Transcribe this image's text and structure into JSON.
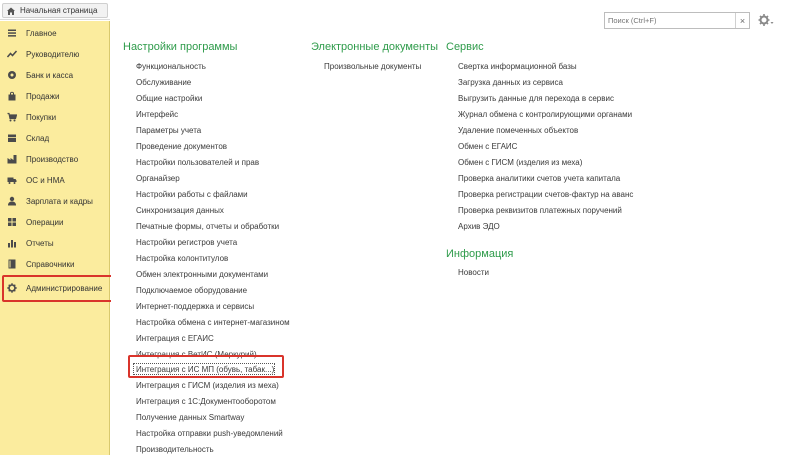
{
  "home_tab": {
    "label": "Начальная страница"
  },
  "sidebar": {
    "items": [
      {
        "label": "Главное",
        "icon": "list-icon"
      },
      {
        "label": "Руководителю",
        "icon": "trend-icon"
      },
      {
        "label": "Банк и касса",
        "icon": "coins-icon"
      },
      {
        "label": "Продажи",
        "icon": "shopping-bag-icon"
      },
      {
        "label": "Покупки",
        "icon": "cart-icon"
      },
      {
        "label": "Склад",
        "icon": "box-icon"
      },
      {
        "label": "Производство",
        "icon": "factory-icon"
      },
      {
        "label": "ОС и НМА",
        "icon": "truck-icon"
      },
      {
        "label": "Зарплата и кадры",
        "icon": "user-icon"
      },
      {
        "label": "Операции",
        "icon": "operations-icon"
      },
      {
        "label": "Отчеты",
        "icon": "bar-chart-icon"
      },
      {
        "label": "Справочники",
        "icon": "book-icon"
      },
      {
        "label": "Администрирование",
        "icon": "gear-icon"
      }
    ]
  },
  "search": {
    "placeholder": "Поиск (Ctrl+F)",
    "clear": "×"
  },
  "sections": {
    "settings": {
      "title": "Настройки программы",
      "links": [
        "Функциональность",
        "Обслуживание",
        "Общие настройки",
        "Интерфейс",
        "Параметры учета",
        "Проведение документов",
        "Настройки пользователей и прав",
        "Органайзер",
        "Настройки работы с файлами",
        "Синхронизация данных",
        "Печатные формы, отчеты и обработки",
        "Настройки регистров учета",
        "Настройка колонтитулов",
        "Обмен электронными документами",
        "Подключаемое оборудование",
        "Интернет-поддержка и сервисы",
        "Настройка обмена с интернет-магазином",
        "Интеграция с ЕГАИС",
        "Интеграция с ВетИС (Меркурий)",
        "Интеграция с ИС МП (обувь, табак...)",
        "Интеграция с ГИСМ (изделия из меха)",
        "Интеграция с 1С:Документооборотом",
        "Получение данных Smartway",
        "Настройка отправки push-уведомлений",
        "Производительность"
      ]
    },
    "edocs": {
      "title": "Электронные документы",
      "links": [
        "Произвольные документы"
      ]
    },
    "service": {
      "title": "Сервис",
      "links": [
        "Свертка информационной базы",
        "Загрузка данных из сервиса",
        "Выгрузить данные для перехода в сервис",
        "Журнал обмена с контролирующими органами",
        "Удаление помеченных объектов",
        "Обмен с ЕГАИС",
        "Обмен с ГИСМ (изделия из меха)",
        "Проверка аналитики счетов учета капитала",
        "Проверка регистрации счетов-фактур на аванс",
        "Проверка реквизитов платежных поручений",
        "Архив ЭДО"
      ]
    },
    "info": {
      "title": "Информация",
      "links": [
        "Новости"
      ]
    }
  },
  "colors": {
    "sidebar_bg": "#fbec9e",
    "section_title": "#2e9b4a",
    "highlight": "#d9342b"
  }
}
